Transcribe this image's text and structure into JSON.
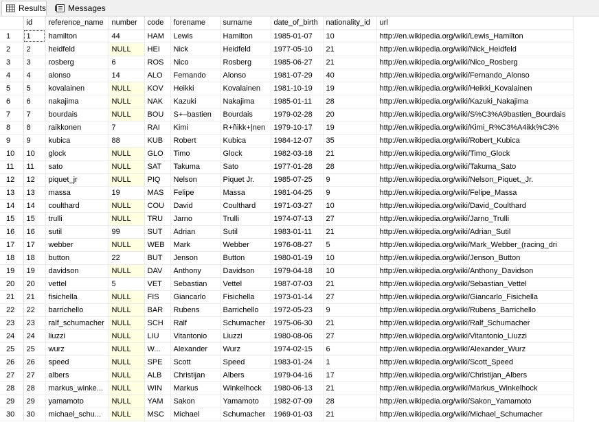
{
  "tabs": [
    {
      "label": "Results",
      "icon": "grid-icon",
      "active": true
    },
    {
      "label": "Messages",
      "icon": "messages-icon",
      "active": false
    }
  ],
  "columns": [
    "",
    "id",
    "reference_name",
    "number",
    "code",
    "forename",
    "surname",
    "date_of_birth",
    "nationality_id",
    "url"
  ],
  "rows": [
    [
      "1",
      "1",
      "hamilton",
      "44",
      "HAM",
      "Lewis",
      "Hamilton",
      "1985-01-07",
      "10",
      "http://en.wikipedia.org/wiki/Lewis_Hamilton"
    ],
    [
      "2",
      "2",
      "heidfeld",
      "NULL",
      "HEI",
      "Nick",
      "Heidfeld",
      "1977-05-10",
      "21",
      "http://en.wikipedia.org/wiki/Nick_Heidfeld"
    ],
    [
      "3",
      "3",
      "rosberg",
      "6",
      "ROS",
      "Nico",
      "Rosberg",
      "1985-06-27",
      "21",
      "http://en.wikipedia.org/wiki/Nico_Rosberg"
    ],
    [
      "4",
      "4",
      "alonso",
      "14",
      "ALO",
      "Fernando",
      "Alonso",
      "1981-07-29",
      "40",
      "http://en.wikipedia.org/wiki/Fernando_Alonso"
    ],
    [
      "5",
      "5",
      "kovalainen",
      "NULL",
      "KOV",
      "Heikki",
      "Kovalainen",
      "1981-10-19",
      "19",
      "http://en.wikipedia.org/wiki/Heikki_Kovalainen"
    ],
    [
      "6",
      "6",
      "nakajima",
      "NULL",
      "NAK",
      "Kazuki",
      "Nakajima",
      "1985-01-11",
      "28",
      "http://en.wikipedia.org/wiki/Kazuki_Nakajima"
    ],
    [
      "7",
      "7",
      "bourdais",
      "NULL",
      "BOU",
      "S+–bastien",
      "Bourdais",
      "1979-02-28",
      "20",
      "http://en.wikipedia.org/wiki/S%C3%A9bastien_Bourdais"
    ],
    [
      "8",
      "8",
      "raikkonen",
      "7",
      "RAI",
      "Kimi",
      "R+ñikk+|nen",
      "1979-10-17",
      "19",
      "http://en.wikipedia.org/wiki/Kimi_R%C3%A4ikk%C3%"
    ],
    [
      "9",
      "9",
      "kubica",
      "88",
      "KUB",
      "Robert",
      "Kubica",
      "1984-12-07",
      "35",
      "http://en.wikipedia.org/wiki/Robert_Kubica"
    ],
    [
      "10",
      "10",
      "glock",
      "NULL",
      "GLO",
      "Timo",
      "Glock",
      "1982-03-18",
      "21",
      "http://en.wikipedia.org/wiki/Timo_Glock"
    ],
    [
      "11",
      "11",
      "sato",
      "NULL",
      "SAT",
      "Takuma",
      "Sato",
      "1977-01-28",
      "28",
      "http://en.wikipedia.org/wiki/Takuma_Sato"
    ],
    [
      "12",
      "12",
      "piquet_jr",
      "NULL",
      "PIQ",
      "Nelson",
      "Piquet Jr.",
      "1985-07-25",
      "9",
      "http://en.wikipedia.org/wiki/Nelson_Piquet,_Jr."
    ],
    [
      "13",
      "13",
      "massa",
      "19",
      "MAS",
      "Felipe",
      "Massa",
      "1981-04-25",
      "9",
      "http://en.wikipedia.org/wiki/Felipe_Massa"
    ],
    [
      "14",
      "14",
      "coulthard",
      "NULL",
      "COU",
      "David",
      "Coulthard",
      "1971-03-27",
      "10",
      "http://en.wikipedia.org/wiki/David_Coulthard"
    ],
    [
      "15",
      "15",
      "trulli",
      "NULL",
      "TRU",
      "Jarno",
      "Trulli",
      "1974-07-13",
      "27",
      "http://en.wikipedia.org/wiki/Jarno_Trulli"
    ],
    [
      "16",
      "16",
      "sutil",
      "99",
      "SUT",
      "Adrian",
      "Sutil",
      "1983-01-11",
      "21",
      "http://en.wikipedia.org/wiki/Adrian_Sutil"
    ],
    [
      "17",
      "17",
      "webber",
      "NULL",
      "WEB",
      "Mark",
      "Webber",
      "1976-08-27",
      "5",
      "http://en.wikipedia.org/wiki/Mark_Webber_(racing_dri"
    ],
    [
      "18",
      "18",
      "button",
      "22",
      "BUT",
      "Jenson",
      "Button",
      "1980-01-19",
      "10",
      "http://en.wikipedia.org/wiki/Jenson_Button"
    ],
    [
      "19",
      "19",
      "davidson",
      "NULL",
      "DAV",
      "Anthony",
      "Davidson",
      "1979-04-18",
      "10",
      "http://en.wikipedia.org/wiki/Anthony_Davidson"
    ],
    [
      "20",
      "20",
      "vettel",
      "5",
      "VET",
      "Sebastian",
      "Vettel",
      "1987-07-03",
      "21",
      "http://en.wikipedia.org/wiki/Sebastian_Vettel"
    ],
    [
      "21",
      "21",
      "fisichella",
      "NULL",
      "FIS",
      "Giancarlo",
      "Fisichella",
      "1973-01-14",
      "27",
      "http://en.wikipedia.org/wiki/Giancarlo_Fisichella"
    ],
    [
      "22",
      "22",
      "barrichello",
      "NULL",
      "BAR",
      "Rubens",
      "Barrichello",
      "1972-05-23",
      "9",
      "http://en.wikipedia.org/wiki/Rubens_Barrichello"
    ],
    [
      "23",
      "23",
      "ralf_schumacher",
      "NULL",
      "SCH",
      "Ralf",
      "Schumacher",
      "1975-06-30",
      "21",
      "http://en.wikipedia.org/wiki/Ralf_Schumacher"
    ],
    [
      "24",
      "24",
      "liuzzi",
      "NULL",
      "LIU",
      "Vitantonio",
      "Liuzzi",
      "1980-08-06",
      "27",
      "http://en.wikipedia.org/wiki/Vitantonio_Liuzzi"
    ],
    [
      "25",
      "25",
      "wurz",
      "NULL",
      "W...",
      "Alexander",
      "Wurz",
      "1974-02-15",
      "6",
      "http://en.wikipedia.org/wiki/Alexander_Wurz"
    ],
    [
      "26",
      "26",
      "speed",
      "NULL",
      "SPE",
      "Scott",
      "Speed",
      "1983-01-24",
      "1",
      "http://en.wikipedia.org/wiki/Scott_Speed"
    ],
    [
      "27",
      "27",
      "albers",
      "NULL",
      "ALB",
      "Christijan",
      "Albers",
      "1979-04-16",
      "17",
      "http://en.wikipedia.org/wiki/Christijan_Albers"
    ],
    [
      "28",
      "28",
      "markus_winke...",
      "NULL",
      "WIN",
      "Markus",
      "Winkelhock",
      "1980-06-13",
      "21",
      "http://en.wikipedia.org/wiki/Markus_Winkelhock"
    ],
    [
      "29",
      "29",
      "yamamoto",
      "NULL",
      "YAM",
      "Sakon",
      "Yamamoto",
      "1982-07-09",
      "28",
      "http://en.wikipedia.org/wiki/Sakon_Yamamoto"
    ],
    [
      "30",
      "30",
      "michael_schu...",
      "NULL",
      "MSC",
      "Michael",
      "Schumacher",
      "1969-01-03",
      "21",
      "http://en.wikipedia.org/wiki/Michael_Schumacher"
    ]
  ],
  "colors": {
    "null_cell": "#ffffe1",
    "grid_line": "#ececec"
  }
}
